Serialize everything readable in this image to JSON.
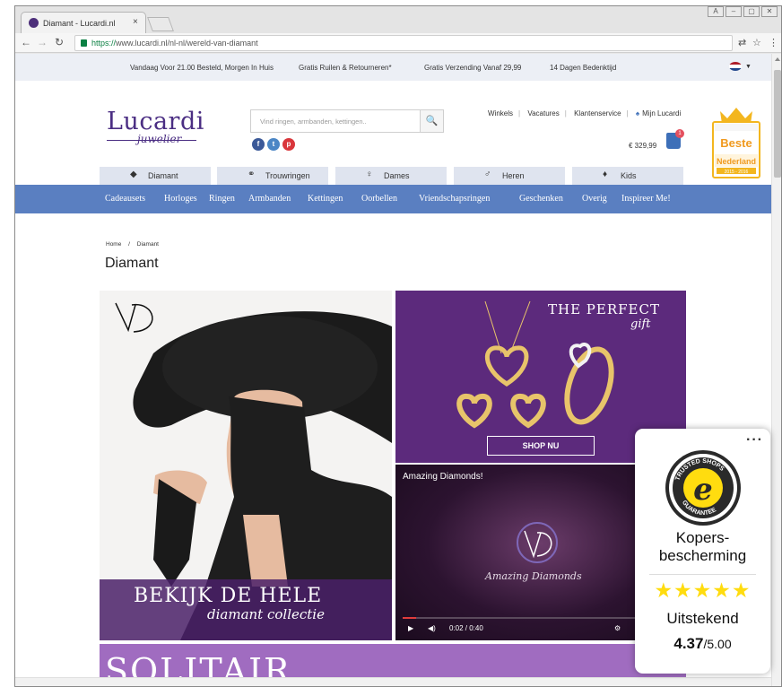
{
  "browser": {
    "tab_title": "Diamant - Lucardi.nl",
    "tab_close": "×",
    "url_scheme": "https://",
    "url_rest": "www.lucardi.nl/nl-nl/wereld-van-diamant",
    "window_controls": [
      "A",
      "–",
      "▢",
      "✕"
    ]
  },
  "usp_bar": {
    "items": [
      "Vandaag Voor 21.00 Besteld, Morgen In Huis",
      "Gratis Ruilen & Retourneren*",
      "Gratis Verzending Vanaf 29,99",
      "14 Dagen Bedenktijd"
    ],
    "flag_colors": [
      "#ae1c28",
      "#ffffff",
      "#21468b"
    ]
  },
  "header": {
    "logo_word": "Lucardi",
    "logo_sub": "juwelier",
    "search_placeholder": "Vind ringen, armbanden, kettingen..",
    "top_links": [
      "Winkels",
      "Vacatures",
      "Klantenservice",
      "Mijn Lucardi"
    ],
    "cart_total": "€ 329,99",
    "cart_count": "1",
    "award_title": "Beste",
    "award_sub": "Nederland",
    "award_years": "2015 - 2016"
  },
  "category_tabs": [
    {
      "icon": "diamond-icon",
      "label": "Diamant"
    },
    {
      "icon": "rings-icon",
      "label": "Trouwringen"
    },
    {
      "icon": "female-icon",
      "label": "Dames"
    },
    {
      "icon": "male-icon",
      "label": "Heren"
    },
    {
      "icon": "kids-icon",
      "label": "Kids"
    }
  ],
  "navbar": {
    "items": [
      "Cadeausets",
      "Horloges",
      "Ringen",
      "Armbanden",
      "Kettingen",
      "Oorbellen",
      "Vriendschapsringen",
      "Geschenken",
      "Overig",
      "Inspireer Me!"
    ]
  },
  "content": {
    "breadcrumb_home": "Home",
    "breadcrumb_sep": "/",
    "breadcrumb_current": "Diamant",
    "page_title": "Diamant",
    "hero_big": "BEKIJK DE HELE",
    "hero_script": "diamant collectie",
    "promo_title": "THE PERFECT",
    "promo_script": "gift",
    "promo_button": "SHOP NU",
    "video_title": "Amazing Diamonds!",
    "video_script": "Amazing Diamonds",
    "video_time": "0:02 / 0:40",
    "video_progress": 0.05,
    "solitair_title": "SOLITAIR"
  },
  "trusted_shops": {
    "menu": "···",
    "protection_line1": "Kopers-",
    "protection_line2": "bescherming",
    "stars": "★★★★★",
    "grade": "Uitstekend",
    "score": "4.37",
    "score_max": "/5.00"
  },
  "colors": {
    "brand_purple": "#4b2e83",
    "nav_blue": "#5a7fc1",
    "tab_bg": "#dfe4ef",
    "star_yellow": "#ffdc0f"
  }
}
